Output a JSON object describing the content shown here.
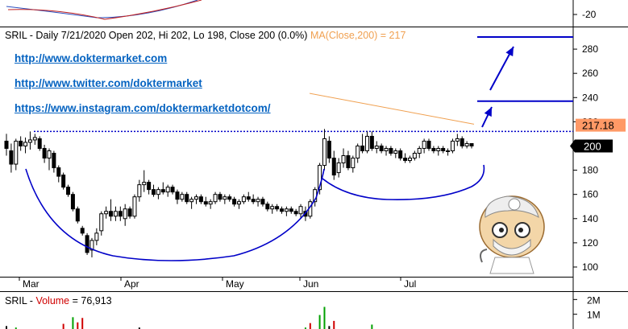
{
  "chart_data": {
    "type": "candlestick",
    "symbol": "SRIL",
    "title_text": "SRIL - Daily 7/21/2020 Open 202, Hi 202, Lo 198, Close 200 (0.0%)",
    "ma_text": "MA(Close,200) = 217",
    "y_ticks": [
      100,
      120,
      140,
      160,
      180,
      200,
      220,
      240,
      260,
      280
    ],
    "ylim": [
      92,
      298
    ],
    "top_panel_ticks": [
      "-20"
    ],
    "x_months": [
      "Mar",
      "Apr",
      "May",
      "Jun",
      "Jul"
    ],
    "ma200_label": "217.18",
    "last_price_label": "200",
    "resistance_level": 212,
    "projected_levels": [
      237,
      290
    ],
    "candles": [
      {
        "o": 204,
        "h": 210,
        "l": 192,
        "c": 198
      },
      {
        "o": 196,
        "h": 202,
        "l": 178,
        "c": 185
      },
      {
        "o": 185,
        "h": 206,
        "l": 180,
        "c": 204
      },
      {
        "o": 204,
        "h": 208,
        "l": 196,
        "c": 200
      },
      {
        "o": 200,
        "h": 207,
        "l": 194,
        "c": 203
      },
      {
        "o": 203,
        "h": 212,
        "l": 197,
        "c": 205
      },
      {
        "o": 205,
        "h": 210,
        "l": 201,
        "c": 207
      },
      {
        "o": 206,
        "h": 208,
        "l": 196,
        "c": 198
      },
      {
        "o": 198,
        "h": 201,
        "l": 186,
        "c": 190
      },
      {
        "o": 190,
        "h": 198,
        "l": 180,
        "c": 196
      },
      {
        "o": 194,
        "h": 196,
        "l": 178,
        "c": 182
      },
      {
        "o": 182,
        "h": 184,
        "l": 170,
        "c": 175
      },
      {
        "o": 176,
        "h": 178,
        "l": 164,
        "c": 166
      },
      {
        "o": 166,
        "h": 168,
        "l": 158,
        "c": 160
      },
      {
        "o": 160,
        "h": 162,
        "l": 146,
        "c": 148
      },
      {
        "o": 148,
        "h": 150,
        "l": 136,
        "c": 138
      },
      {
        "o": 132,
        "h": 134,
        "l": 126,
        "c": 128
      },
      {
        "o": 126,
        "h": 128,
        "l": 110,
        "c": 112
      },
      {
        "o": 114,
        "h": 124,
        "l": 108,
        "c": 122
      },
      {
        "o": 122,
        "h": 132,
        "l": 118,
        "c": 128
      },
      {
        "o": 130,
        "h": 146,
        "l": 126,
        "c": 144
      },
      {
        "o": 144,
        "h": 150,
        "l": 140,
        "c": 146
      },
      {
        "o": 146,
        "h": 156,
        "l": 138,
        "c": 142
      },
      {
        "o": 142,
        "h": 150,
        "l": 138,
        "c": 146
      },
      {
        "o": 146,
        "h": 150,
        "l": 138,
        "c": 142
      },
      {
        "o": 140,
        "h": 152,
        "l": 134,
        "c": 148
      },
      {
        "o": 148,
        "h": 150,
        "l": 140,
        "c": 142
      },
      {
        "o": 142,
        "h": 160,
        "l": 140,
        "c": 158
      },
      {
        "o": 158,
        "h": 172,
        "l": 154,
        "c": 168
      },
      {
        "o": 168,
        "h": 180,
        "l": 162,
        "c": 170
      },
      {
        "o": 170,
        "h": 172,
        "l": 160,
        "c": 164
      },
      {
        "o": 164,
        "h": 168,
        "l": 158,
        "c": 160
      },
      {
        "o": 160,
        "h": 166,
        "l": 156,
        "c": 164
      },
      {
        "o": 164,
        "h": 170,
        "l": 160,
        "c": 162
      },
      {
        "o": 162,
        "h": 168,
        "l": 158,
        "c": 166
      },
      {
        "o": 166,
        "h": 168,
        "l": 160,
        "c": 162
      },
      {
        "o": 162,
        "h": 164,
        "l": 152,
        "c": 156
      },
      {
        "o": 156,
        "h": 162,
        "l": 154,
        "c": 160
      },
      {
        "o": 160,
        "h": 162,
        "l": 152,
        "c": 154
      },
      {
        "o": 154,
        "h": 158,
        "l": 148,
        "c": 156
      },
      {
        "o": 156,
        "h": 160,
        "l": 152,
        "c": 158
      },
      {
        "o": 158,
        "h": 160,
        "l": 152,
        "c": 154
      },
      {
        "o": 154,
        "h": 158,
        "l": 150,
        "c": 152
      },
      {
        "o": 152,
        "h": 156,
        "l": 148,
        "c": 154
      },
      {
        "o": 154,
        "h": 162,
        "l": 152,
        "c": 160
      },
      {
        "o": 160,
        "h": 162,
        "l": 154,
        "c": 156
      },
      {
        "o": 156,
        "h": 160,
        "l": 152,
        "c": 158
      },
      {
        "o": 158,
        "h": 160,
        "l": 154,
        "c": 156
      },
      {
        "o": 156,
        "h": 158,
        "l": 150,
        "c": 152
      },
      {
        "o": 152,
        "h": 156,
        "l": 148,
        "c": 154
      },
      {
        "o": 154,
        "h": 160,
        "l": 152,
        "c": 158
      },
      {
        "o": 158,
        "h": 162,
        "l": 154,
        "c": 156
      },
      {
        "o": 156,
        "h": 160,
        "l": 152,
        "c": 154
      },
      {
        "o": 154,
        "h": 158,
        "l": 150,
        "c": 156
      },
      {
        "o": 156,
        "h": 158,
        "l": 150,
        "c": 152
      },
      {
        "o": 152,
        "h": 154,
        "l": 146,
        "c": 148
      },
      {
        "o": 148,
        "h": 152,
        "l": 144,
        "c": 150
      },
      {
        "o": 150,
        "h": 152,
        "l": 146,
        "c": 148
      },
      {
        "o": 148,
        "h": 150,
        "l": 144,
        "c": 146
      },
      {
        "o": 146,
        "h": 150,
        "l": 142,
        "c": 148
      },
      {
        "o": 148,
        "h": 150,
        "l": 144,
        "c": 146
      },
      {
        "o": 146,
        "h": 148,
        "l": 142,
        "c": 144
      },
      {
        "o": 144,
        "h": 152,
        "l": 140,
        "c": 150
      },
      {
        "o": 146,
        "h": 150,
        "l": 138,
        "c": 142
      },
      {
        "o": 142,
        "h": 156,
        "l": 140,
        "c": 154
      },
      {
        "o": 154,
        "h": 166,
        "l": 150,
        "c": 164
      },
      {
        "o": 164,
        "h": 186,
        "l": 160,
        "c": 184
      },
      {
        "o": 184,
        "h": 214,
        "l": 180,
        "c": 206
      },
      {
        "o": 204,
        "h": 208,
        "l": 186,
        "c": 190
      },
      {
        "o": 190,
        "h": 196,
        "l": 172,
        "c": 176
      },
      {
        "o": 178,
        "h": 190,
        "l": 174,
        "c": 186
      },
      {
        "o": 186,
        "h": 198,
        "l": 182,
        "c": 192
      },
      {
        "o": 192,
        "h": 196,
        "l": 180,
        "c": 182
      },
      {
        "o": 182,
        "h": 192,
        "l": 178,
        "c": 190
      },
      {
        "o": 190,
        "h": 202,
        "l": 186,
        "c": 200
      },
      {
        "o": 200,
        "h": 210,
        "l": 194,
        "c": 196
      },
      {
        "o": 196,
        "h": 212,
        "l": 194,
        "c": 208
      },
      {
        "o": 208,
        "h": 212,
        "l": 196,
        "c": 198
      },
      {
        "o": 198,
        "h": 204,
        "l": 194,
        "c": 200
      },
      {
        "o": 200,
        "h": 202,
        "l": 194,
        "c": 196
      },
      {
        "o": 196,
        "h": 200,
        "l": 192,
        "c": 198
      },
      {
        "o": 198,
        "h": 200,
        "l": 192,
        "c": 194
      },
      {
        "o": 194,
        "h": 198,
        "l": 190,
        "c": 196
      },
      {
        "o": 196,
        "h": 198,
        "l": 188,
        "c": 190
      },
      {
        "o": 190,
        "h": 194,
        "l": 186,
        "c": 188
      },
      {
        "o": 188,
        "h": 192,
        "l": 186,
        "c": 190
      },
      {
        "o": 190,
        "h": 196,
        "l": 188,
        "c": 194
      },
      {
        "o": 194,
        "h": 200,
        "l": 190,
        "c": 198
      },
      {
        "o": 198,
        "h": 206,
        "l": 194,
        "c": 204
      },
      {
        "o": 204,
        "h": 206,
        "l": 196,
        "c": 198
      },
      {
        "o": 198,
        "h": 200,
        "l": 194,
        "c": 196
      },
      {
        "o": 196,
        "h": 200,
        "l": 192,
        "c": 198
      },
      {
        "o": 198,
        "h": 200,
        "l": 194,
        "c": 196
      },
      {
        "o": 196,
        "h": 198,
        "l": 192,
        "c": 196
      },
      {
        "o": 196,
        "h": 206,
        "l": 194,
        "c": 204
      },
      {
        "o": 204,
        "h": 210,
        "l": 200,
        "c": 206
      },
      {
        "o": 206,
        "h": 208,
        "l": 198,
        "c": 200
      },
      {
        "o": 200,
        "h": 204,
        "l": 198,
        "c": 202
      },
      {
        "o": 202,
        "h": 202,
        "l": 198,
        "c": 200
      }
    ],
    "volume": {
      "label": "Volume",
      "value_text": "76,913",
      "y_ticks": [
        "2M",
        "1M"
      ],
      "ylim": [
        0,
        2400000
      ],
      "bars": [
        {
          "v": 200000,
          "c": "black"
        },
        {
          "v": 0,
          "c": "black"
        },
        {
          "v": 100000,
          "c": "green"
        },
        {
          "v": 0,
          "c": "black"
        },
        {
          "v": 0,
          "c": "black"
        },
        {
          "v": 0,
          "c": "black"
        },
        {
          "v": 0,
          "c": "black"
        },
        {
          "v": 0,
          "c": "black"
        },
        {
          "v": 0,
          "c": "black"
        },
        {
          "v": 0,
          "c": "black"
        },
        {
          "v": 0,
          "c": "black"
        },
        {
          "v": 0,
          "c": "black"
        },
        {
          "v": 350000,
          "c": "red"
        },
        {
          "v": 0,
          "c": "black"
        },
        {
          "v": 800000,
          "c": "green"
        },
        {
          "v": 450000,
          "c": "red"
        },
        {
          "v": 750000,
          "c": "red"
        },
        {
          "v": 0,
          "c": "black"
        },
        {
          "v": 0,
          "c": "black"
        },
        {
          "v": 0,
          "c": "black"
        },
        {
          "v": 0,
          "c": "black"
        },
        {
          "v": 0,
          "c": "black"
        },
        {
          "v": 0,
          "c": "black"
        },
        {
          "v": 0,
          "c": "black"
        },
        {
          "v": 0,
          "c": "black"
        },
        {
          "v": 0,
          "c": "black"
        },
        {
          "v": 0,
          "c": "black"
        },
        {
          "v": 0,
          "c": "black"
        },
        {
          "v": 100000,
          "c": "black"
        },
        {
          "v": 0,
          "c": "black"
        },
        {
          "v": 0,
          "c": "black"
        },
        {
          "v": 0,
          "c": "black"
        },
        {
          "v": 0,
          "c": "black"
        },
        {
          "v": 0,
          "c": "black"
        },
        {
          "v": 0,
          "c": "black"
        },
        {
          "v": 0,
          "c": "black"
        },
        {
          "v": 0,
          "c": "black"
        },
        {
          "v": 0,
          "c": "black"
        },
        {
          "v": 0,
          "c": "black"
        },
        {
          "v": 0,
          "c": "black"
        },
        {
          "v": 0,
          "c": "black"
        },
        {
          "v": 0,
          "c": "black"
        },
        {
          "v": 0,
          "c": "black"
        },
        {
          "v": 0,
          "c": "black"
        },
        {
          "v": 0,
          "c": "black"
        },
        {
          "v": 0,
          "c": "black"
        },
        {
          "v": 0,
          "c": "black"
        },
        {
          "v": 0,
          "c": "black"
        },
        {
          "v": 0,
          "c": "black"
        },
        {
          "v": 0,
          "c": "black"
        },
        {
          "v": 0,
          "c": "black"
        },
        {
          "v": 0,
          "c": "black"
        },
        {
          "v": 0,
          "c": "black"
        },
        {
          "v": 0,
          "c": "black"
        },
        {
          "v": 0,
          "c": "black"
        },
        {
          "v": 0,
          "c": "black"
        },
        {
          "v": 0,
          "c": "black"
        },
        {
          "v": 0,
          "c": "black"
        },
        {
          "v": 0,
          "c": "black"
        },
        {
          "v": 0,
          "c": "black"
        },
        {
          "v": 0,
          "c": "black"
        },
        {
          "v": 0,
          "c": "black"
        },
        {
          "v": 0,
          "c": "black"
        },
        {
          "v": 100000,
          "c": "green"
        },
        {
          "v": 400000,
          "c": "red"
        },
        {
          "v": 0,
          "c": "black"
        },
        {
          "v": 950000,
          "c": "green"
        },
        {
          "v": 1500000,
          "c": "green"
        },
        {
          "v": 200000,
          "c": "black"
        },
        {
          "v": 550000,
          "c": "red"
        },
        {
          "v": 0,
          "c": "black"
        },
        {
          "v": 0,
          "c": "black"
        },
        {
          "v": 0,
          "c": "black"
        },
        {
          "v": 0,
          "c": "black"
        },
        {
          "v": 0,
          "c": "black"
        },
        {
          "v": 0,
          "c": "black"
        },
        {
          "v": 0,
          "c": "black"
        },
        {
          "v": 300000,
          "c": "green"
        },
        {
          "v": 0,
          "c": "black"
        },
        {
          "v": 0,
          "c": "black"
        },
        {
          "v": 0,
          "c": "black"
        },
        {
          "v": 0,
          "c": "black"
        },
        {
          "v": 0,
          "c": "black"
        },
        {
          "v": 0,
          "c": "black"
        },
        {
          "v": 0,
          "c": "black"
        },
        {
          "v": 0,
          "c": "black"
        },
        {
          "v": 0,
          "c": "black"
        },
        {
          "v": 0,
          "c": "black"
        },
        {
          "v": 0,
          "c": "black"
        },
        {
          "v": 0,
          "c": "black"
        },
        {
          "v": 0,
          "c": "black"
        },
        {
          "v": 0,
          "c": "black"
        },
        {
          "v": 0,
          "c": "black"
        },
        {
          "v": 0,
          "c": "black"
        },
        {
          "v": 0,
          "c": "black"
        },
        {
          "v": 0,
          "c": "black"
        },
        {
          "v": 0,
          "c": "black"
        },
        {
          "v": 0,
          "c": "black"
        },
        {
          "v": 0,
          "c": "black"
        }
      ]
    }
  },
  "links": [
    "http://www.doktermarket.com",
    "http://www.twitter.com/doktermarket",
    "https://www.instagram.com/doktermarketdotcom/"
  ],
  "colors": {
    "up": "#000000",
    "down": "#000000",
    "ma": "#f0a050",
    "annotation": "#0000c8",
    "price_box": "#000000",
    "ma_box": "#ff9966",
    "volume_green": "#00a000",
    "volume_red": "#d00000"
  },
  "mascot": "doctor-mascot-icon"
}
